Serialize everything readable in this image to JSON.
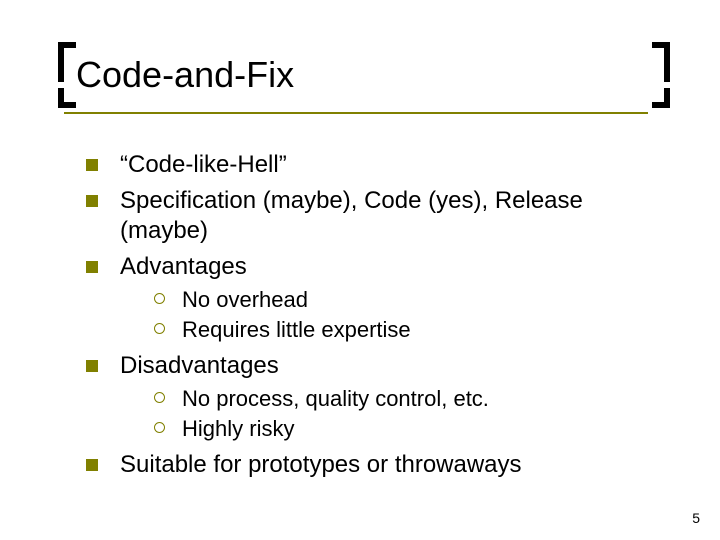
{
  "title": "Code-and-Fix",
  "bullets": [
    {
      "text": "“Code-like-Hell”"
    },
    {
      "text": "Specification (maybe), Code (yes), Release (maybe)"
    },
    {
      "text": "Advantages",
      "sub": [
        "No overhead",
        "Requires little expertise"
      ]
    },
    {
      "text": "Disadvantages",
      "sub": [
        "No process, quality control, etc.",
        "Highly risky"
      ]
    },
    {
      "text": "Suitable for prototypes or throwaways"
    }
  ],
  "page_number": "5"
}
